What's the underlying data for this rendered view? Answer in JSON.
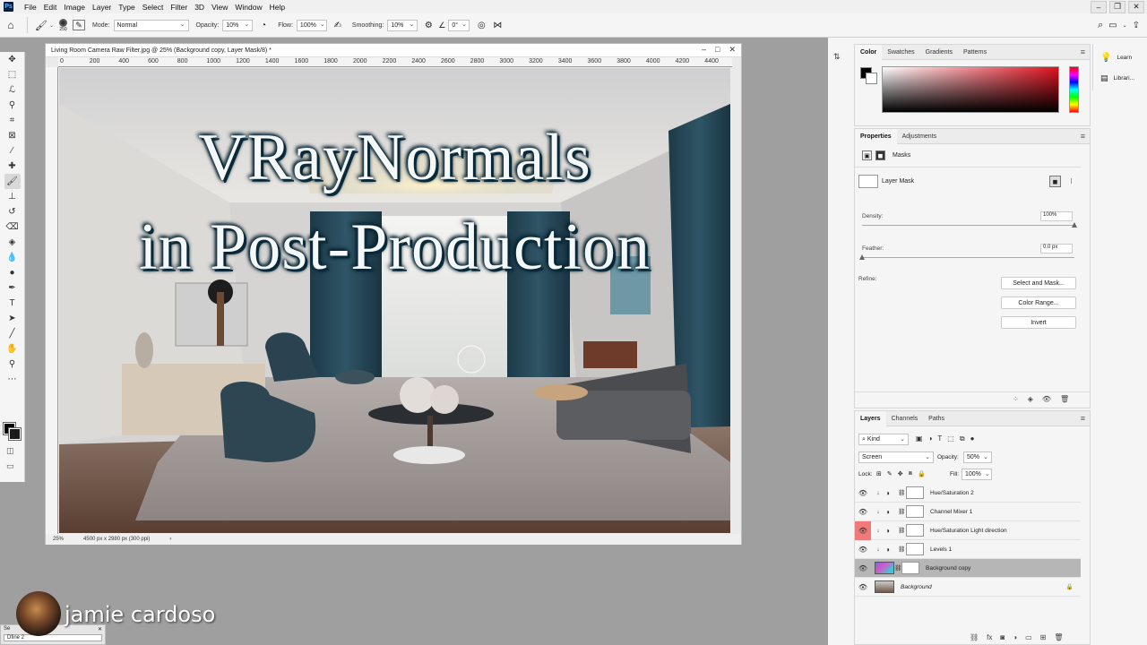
{
  "menubar": {
    "logo": "Ps",
    "items": [
      "File",
      "Edit",
      "Image",
      "Layer",
      "Type",
      "Select",
      "Filter",
      "3D",
      "View",
      "Window",
      "Help"
    ]
  },
  "options": {
    "brush_size": "250",
    "mode_label": "Mode:",
    "mode_value": "Normal",
    "opacity_label": "Opacity:",
    "opacity_value": "10%",
    "flow_label": "Flow:",
    "flow_value": "100%",
    "smoothing_label": "Smoothing:",
    "smoothing_value": "10%",
    "angle_value": "0°"
  },
  "document": {
    "title": "Living Room Camera Raw Filter.jpg @ 25% (Background copy, Layer Mask/8) *",
    "ruler_labels": [
      "0",
      "200",
      "400",
      "600",
      "800",
      "1000",
      "1200",
      "1400",
      "1600",
      "1800",
      "2000",
      "2200",
      "2400",
      "2600",
      "2800",
      "3000",
      "3200",
      "3400",
      "3600",
      "3800",
      "4000",
      "4200",
      "4400"
    ],
    "headline_line1": "VRayNormals",
    "headline_line2": "in Post-Production",
    "zoom": "25%",
    "dimensions": "4500 px x 2980 px (300 ppi)",
    "status_arrow": "›"
  },
  "color_panel": {
    "tabs": [
      "Color",
      "Swatches",
      "Gradients",
      "Patterns"
    ],
    "fg_color": "#000000",
    "spectrum_hue": "#e0121f"
  },
  "learn_panel": {
    "learn_label": "Learn",
    "libraries_label": "Librari..."
  },
  "properties_panel": {
    "tabs": [
      "Properties",
      "Adjustments"
    ],
    "section": "Masks",
    "layer_mask_label": "Layer Mask",
    "density_label": "Density:",
    "density_value": "100%",
    "density_level": 1.0,
    "feather_label": "Feather:",
    "feather_value": "0.0 px",
    "feather_level": 0.0,
    "refine_label": "Refine:",
    "buttons": [
      "Select and Mask...",
      "Color Range...",
      "Invert"
    ]
  },
  "layers_panel": {
    "tabs": [
      "Layers",
      "Channels",
      "Paths"
    ],
    "kind_value": "Kind",
    "blend_mode": "Screen",
    "opacity_label": "Opacity:",
    "opacity_value": "50%",
    "lock_label": "Lock:",
    "fill_label": "Fill:",
    "fill_value": "100%",
    "layers": [
      {
        "name": "Hue/Saturation 2"
      },
      {
        "name": "Channel Mixer 1"
      },
      {
        "name": "Hue/Saturation Light direction"
      },
      {
        "name": "Levels 1"
      },
      {
        "name": "Background copy"
      },
      {
        "name": "Background"
      }
    ]
  },
  "overlay": {
    "presenter": "jamie cardoso",
    "mini_window_title": "Se",
    "mini_window_item": "Dfine 2"
  }
}
